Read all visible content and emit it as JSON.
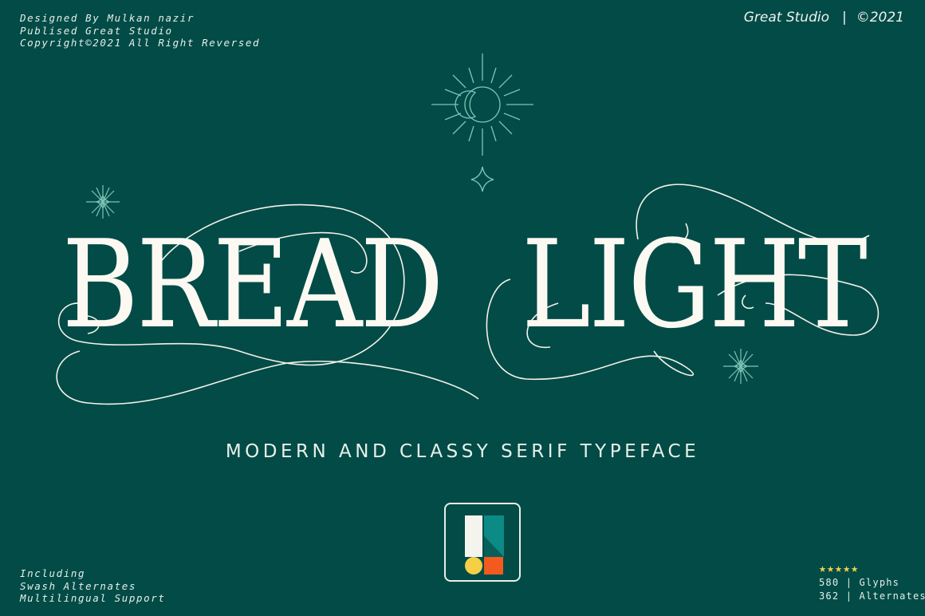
{
  "credits": {
    "designer": "Designed By Mulkan nazir",
    "publisher": "Publised Great Studio",
    "copyright": "Copyright©2021 All Right Reversed"
  },
  "studio": {
    "name": "Great Studio",
    "separator": "|",
    "year": "©2021"
  },
  "title": {
    "word1": "BREAD",
    "word2": "LIGHT"
  },
  "tagline": "MODERN AND CLASSY SERIF TYPEFACE",
  "features": {
    "heading": "Including",
    "item1": "Swash Alternates",
    "item2": "Multilingual Support"
  },
  "stats": {
    "stars": "★★★★★",
    "rating": 5,
    "glyphs": "580 | Glyphs",
    "alternates": "362 | Alternates"
  },
  "icons": [
    "sun-ornament-icon",
    "four-point-star-icon",
    "sparkle-icon",
    "studio-logo-icon"
  ],
  "colors": {
    "background": "#024b47",
    "ornament": "#7fc3b7",
    "title": "#fbf9f2",
    "stars": "#f4d04f",
    "logo_teal": "#0b8a86",
    "logo_yellow": "#f5cf45",
    "logo_orange": "#f25a1e"
  }
}
